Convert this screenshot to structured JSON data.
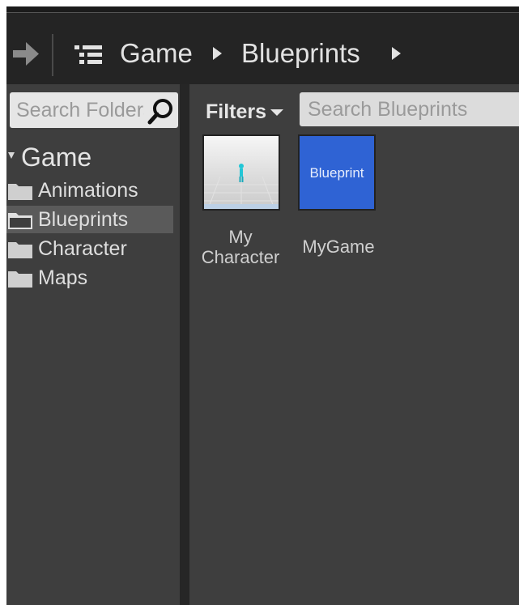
{
  "breadcrumbs": {
    "items": [
      "Game",
      "Blueprints"
    ]
  },
  "sources": {
    "search_placeholder": "Search Folders",
    "root": "Game",
    "folders": [
      "Animations",
      "Blueprints",
      "Character",
      "Maps"
    ],
    "selected_folder": "Blueprints"
  },
  "assets_panel": {
    "filters_label": "Filters",
    "search_placeholder": "Search Blueprints",
    "assets": [
      {
        "name_line1": "My",
        "name_line2": "Character"
      },
      {
        "name_line1": "MyGame",
        "thumb_text": "Blueprint"
      }
    ]
  },
  "icons": {
    "forward": "arrow-right-icon",
    "path_view": "list-tree-icon",
    "search": "magnifier-icon",
    "folder": "folder-icon",
    "breadcrumb_separator": "caret-right-icon"
  },
  "colors": {
    "blueprint_thumb": "#2f63d4",
    "panel_bg": "#3e3e3e",
    "toolbar_bg": "#242424"
  }
}
